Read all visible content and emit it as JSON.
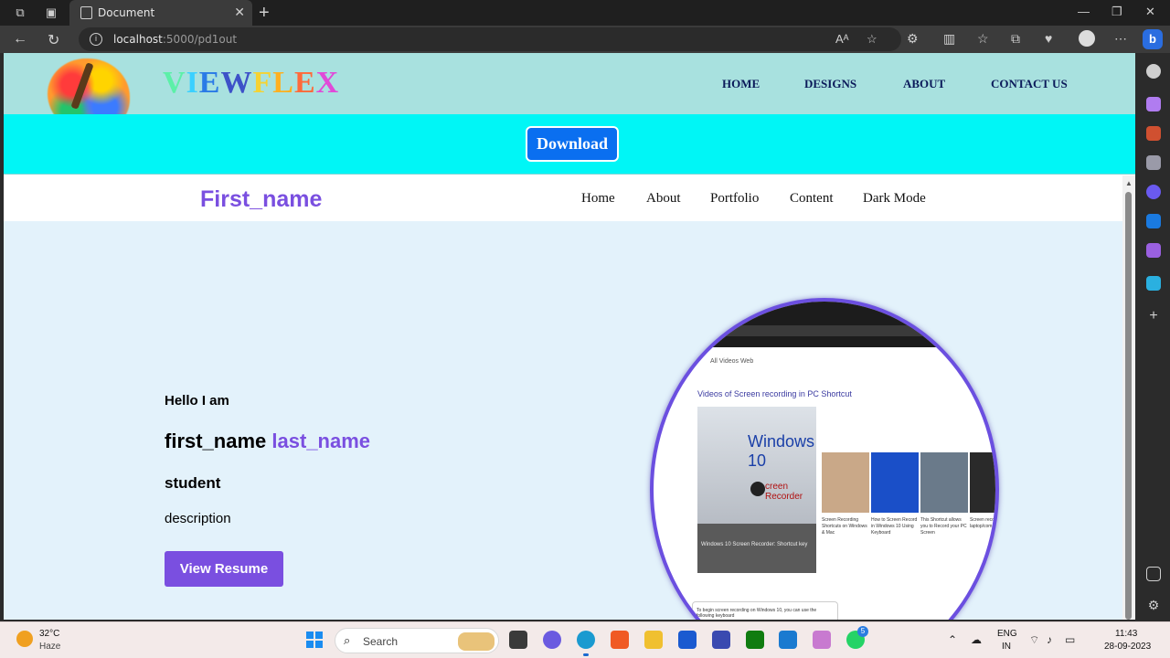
{
  "browser": {
    "tab_title": "Document",
    "url_host": "localhost",
    "url_rest": ":5000/pd1out"
  },
  "site": {
    "brand_letters": [
      {
        "ch": "V",
        "color": "#5cf0a8"
      },
      {
        "ch": "I",
        "color": "#3ad0ff"
      },
      {
        "ch": "E",
        "color": "#2a7be6"
      },
      {
        "ch": "W",
        "color": "#3d51c8"
      },
      {
        "ch": "F",
        "color": "#f5d232"
      },
      {
        "ch": "L",
        "color": "#ffb020"
      },
      {
        "ch": "E",
        "color": "#ff6a3a"
      },
      {
        "ch": "X",
        "color": "#e04ad8"
      }
    ],
    "nav": [
      "HOME",
      "DESIGNS",
      "ABOUT",
      "CONTACT US"
    ],
    "download_label": "Download"
  },
  "portfolio": {
    "brand": "First_name",
    "nav": [
      "Home",
      "About",
      "Portfolio",
      "Content",
      "Dark Mode"
    ],
    "hello": "Hello I am",
    "first_name": "first_name",
    "last_name": "last_name",
    "role": "student",
    "description": "description",
    "resume_label": "View Resume",
    "accent": "#7a4fe0"
  },
  "preview": {
    "breadcrumb": "All   Videos   Web",
    "video_heading": "Videos of Screen recording in PC Shortcut",
    "thumb_title": "Windows 10",
    "thumb_sub": "creen Recorder",
    "thumb_caption": "Windows 10 Screen Recorder: Shortcut key",
    "small_captions": [
      "Screen Recording Shortcuts on Windows & Mac",
      "How to Screen Record in Windows 10 Using Keyboard",
      "This Shortcut allows you to Record your PC Screen",
      "Screen record laptop/com"
    ],
    "note": "To begin screen recording on Windows 10, you can use the following keyboard"
  },
  "taskbar": {
    "temp": "32°C",
    "condition": "Haze",
    "search_label": "Search",
    "badge_count": "5",
    "lang_top": "ENG",
    "lang_bottom": "IN",
    "time": "11:43",
    "date": "28-09-2023"
  }
}
